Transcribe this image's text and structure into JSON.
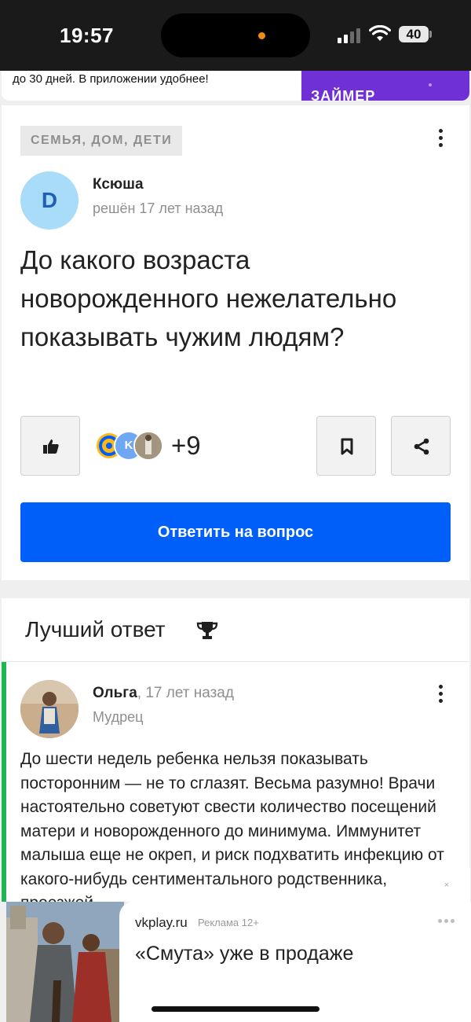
{
  "status_bar": {
    "time": "19:57",
    "battery": "40",
    "icons": [
      "signal-icon",
      "wifi-icon",
      "battery-icon"
    ]
  },
  "top_ad": {
    "text": "до 30 дней. В приложении удобнее!",
    "label": "ЗАЙМЕР",
    "accent": "#6f30d6"
  },
  "question": {
    "category": "СЕМЬЯ, ДОМ, ДЕТИ",
    "avatar_letter": "D",
    "author": "Ксюша",
    "meta": "решён 17 лет назад",
    "title": "До какого возраста новорожденного нежелательно показывать чужим людям?",
    "likers_more": "+9",
    "answer_button": "Ответить на вопрос",
    "icons": [
      "thumbs-up-icon",
      "bookmark-icon",
      "share-icon",
      "more-vertical-icon"
    ]
  },
  "best_answer": {
    "heading": "Лучший ответ",
    "author": "Ольга",
    "time": ", 17 лет назад",
    "rank": "Мудрец",
    "text": "До шести недель ребенка нельзя показывать посторонним — не то сглазят. Весьма разумно! Врачи настоятельно советуют свести количество посещений матери и новорожденного до минимума. Иммунитет малыша еще не окреп, и риск подхватить инфекцию от какого-нибудь сентиментального родственника, проезжей...",
    "accent": "#21b654",
    "icons": [
      "trophy-icon",
      "more-vertical-icon"
    ]
  },
  "bottom_ad": {
    "domain": "vkplay.ru",
    "marker": "Реклама 12+",
    "title": "«Смута» уже в продаже",
    "close": "×"
  },
  "colors": {
    "primary": "#005ff9",
    "background": "#efefef"
  }
}
